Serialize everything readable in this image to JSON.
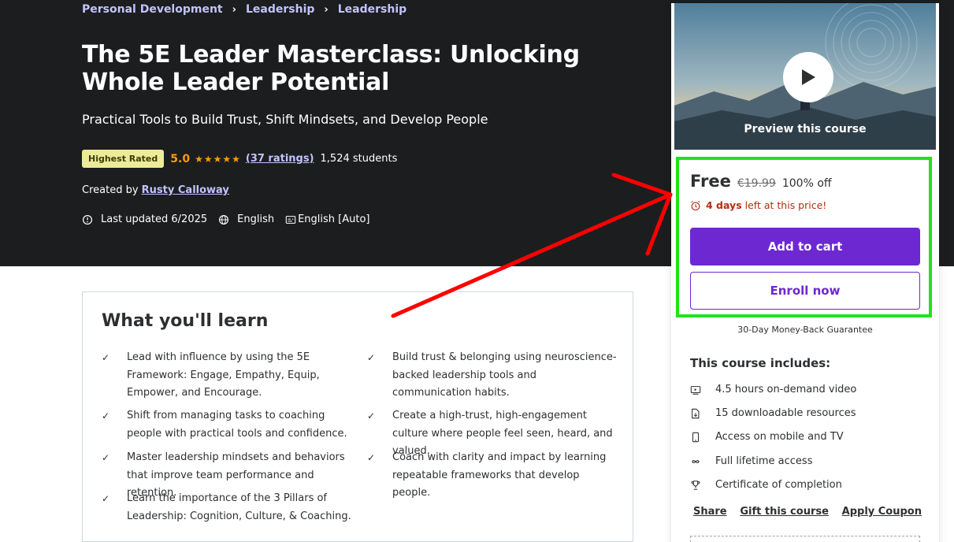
{
  "breadcrumb": [
    "Personal Development",
    "Leadership",
    "Leadership"
  ],
  "course": {
    "title": "The 5E Leader Masterclass: Unlocking Whole Leader Potential",
    "subtitle": "Practical Tools to Build Trust, Shift Mindsets, and Develop People",
    "badge": "Highest Rated",
    "rating": "5.0",
    "stars": "★★★★★",
    "ratings_link": "(37 ratings)",
    "students": "1,524 students",
    "created_by_label": "Created by",
    "instructor": "Rusty Calloway",
    "last_updated": "Last updated 6/2025",
    "language": "English",
    "captions": "English [Auto]"
  },
  "learn": {
    "title": "What you'll learn",
    "items": [
      "Lead with influence by using the 5E Framework: Engage, Empathy, Equip, Empower, and Encourage.",
      "Build trust & belonging using neuroscience-backed leadership tools and communication habits.",
      "Shift from managing tasks to coaching people with practical tools and confidence.",
      "Create a high-trust, high-engagement culture where people feel seen, heard, and valued.",
      "Master leadership mindsets and behaviors that improve team performance and retention.",
      "Coach with clarity and impact by learning repeatable frameworks that develop people.",
      "Learn the importance of the 3 Pillars of Leadership: Cognition, Culture, & Coaching."
    ],
    "check_glyph": "✓"
  },
  "sidebar": {
    "preview_label": "Preview this course",
    "price": "Free",
    "original_price": "€19.99",
    "discount": "100% off",
    "timer_bold": "4 days",
    "timer_rest": "left at this price!",
    "add_to_cart": "Add to cart",
    "enroll_now": "Enroll now",
    "guarantee": "30-Day Money-Back Guarantee",
    "includes_title": "This course includes:",
    "includes": [
      {
        "icon": "video-icon",
        "label": "4.5 hours on-demand video"
      },
      {
        "icon": "file-download-icon",
        "label": "15 downloadable resources"
      },
      {
        "icon": "mobile-icon",
        "label": "Access on mobile and TV"
      },
      {
        "icon": "infinity-icon",
        "label": "Full lifetime access"
      },
      {
        "icon": "trophy-icon",
        "label": "Certificate of completion"
      }
    ],
    "links": {
      "share": "Share",
      "gift": "Gift this course",
      "coupon": "Apply Coupon"
    }
  },
  "colors": {
    "hero_bg": "#1c1d1f",
    "link_purple": "#c0c4fc",
    "star_orange": "#f69c08",
    "primary_purple": "#6d28d2",
    "highlight_green": "#21e21a",
    "annotation_red": "#ff0000",
    "timer_red": "#b32d0f"
  }
}
